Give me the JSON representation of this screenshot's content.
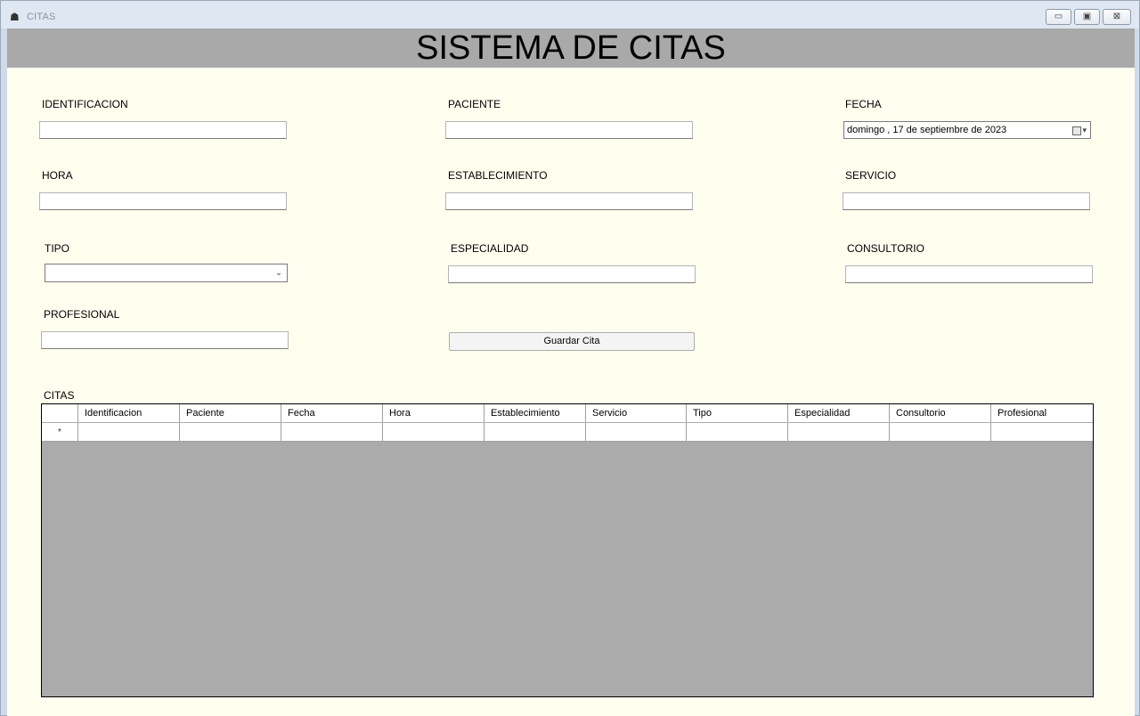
{
  "window": {
    "title": "CITAS",
    "app_icon": "database-icon",
    "buttons": {
      "minimize": "▭",
      "maximize": "▣",
      "close": "⊠"
    }
  },
  "header": {
    "title": "SISTEMA DE CITAS"
  },
  "form": {
    "identificacion": {
      "label": "IDENTIFICACION",
      "value": ""
    },
    "paciente": {
      "label": "PACIENTE",
      "value": ""
    },
    "fecha": {
      "label": "FECHA",
      "value": "domingo , 17 de septiembre de 2023"
    },
    "hora": {
      "label": "HORA",
      "value": ""
    },
    "establecimiento": {
      "label": "ESTABLECIMIENTO",
      "value": ""
    },
    "servicio": {
      "label": "SERVICIO",
      "value": ""
    },
    "tipo": {
      "label": "TIPO",
      "value": ""
    },
    "especialidad": {
      "label": "ESPECIALIDAD",
      "value": ""
    },
    "consultorio": {
      "label": "CONSULTORIO",
      "value": ""
    },
    "profesional": {
      "label": "PROFESIONAL",
      "value": ""
    },
    "save_button": "Guardar Cita"
  },
  "grid": {
    "label": "CITAS",
    "columns": [
      "Identificacion",
      "Paciente",
      "Fecha",
      "Hora",
      "Establecimiento",
      "Servicio",
      "Tipo",
      "Especialidad",
      "Consultorio",
      "Profesional"
    ],
    "new_row_marker": "*"
  },
  "colors": {
    "form_background": "#fffff0",
    "header_background": "#a9a9a9",
    "grid_background": "#ababab"
  }
}
